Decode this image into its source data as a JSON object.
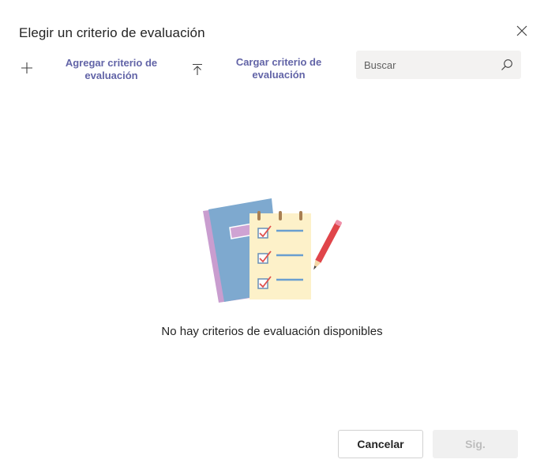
{
  "dialog": {
    "title": "Elegir un criterio de evaluación",
    "close_icon": "close-icon"
  },
  "toolbar": {
    "add": {
      "label": "Agregar criterio de evaluación",
      "icon": "plus-icon"
    },
    "upload": {
      "label": "Cargar criterio de evaluación",
      "icon": "upload-icon"
    },
    "search": {
      "placeholder": "Buscar",
      "value": "",
      "icon": "search-icon"
    }
  },
  "empty_state": {
    "illustration": "notebook-checklist-illustration",
    "message": "No hay criterios de evaluación disponibles"
  },
  "footer": {
    "cancel_label": "Cancelar",
    "next_label": "Sig.",
    "next_enabled": false
  },
  "colors": {
    "accent": "#6264a7",
    "text": "#242424",
    "search_bg": "#f3f2f1",
    "disabled_bg": "#f0f0f0",
    "disabled_text": "#bdbdbd"
  }
}
